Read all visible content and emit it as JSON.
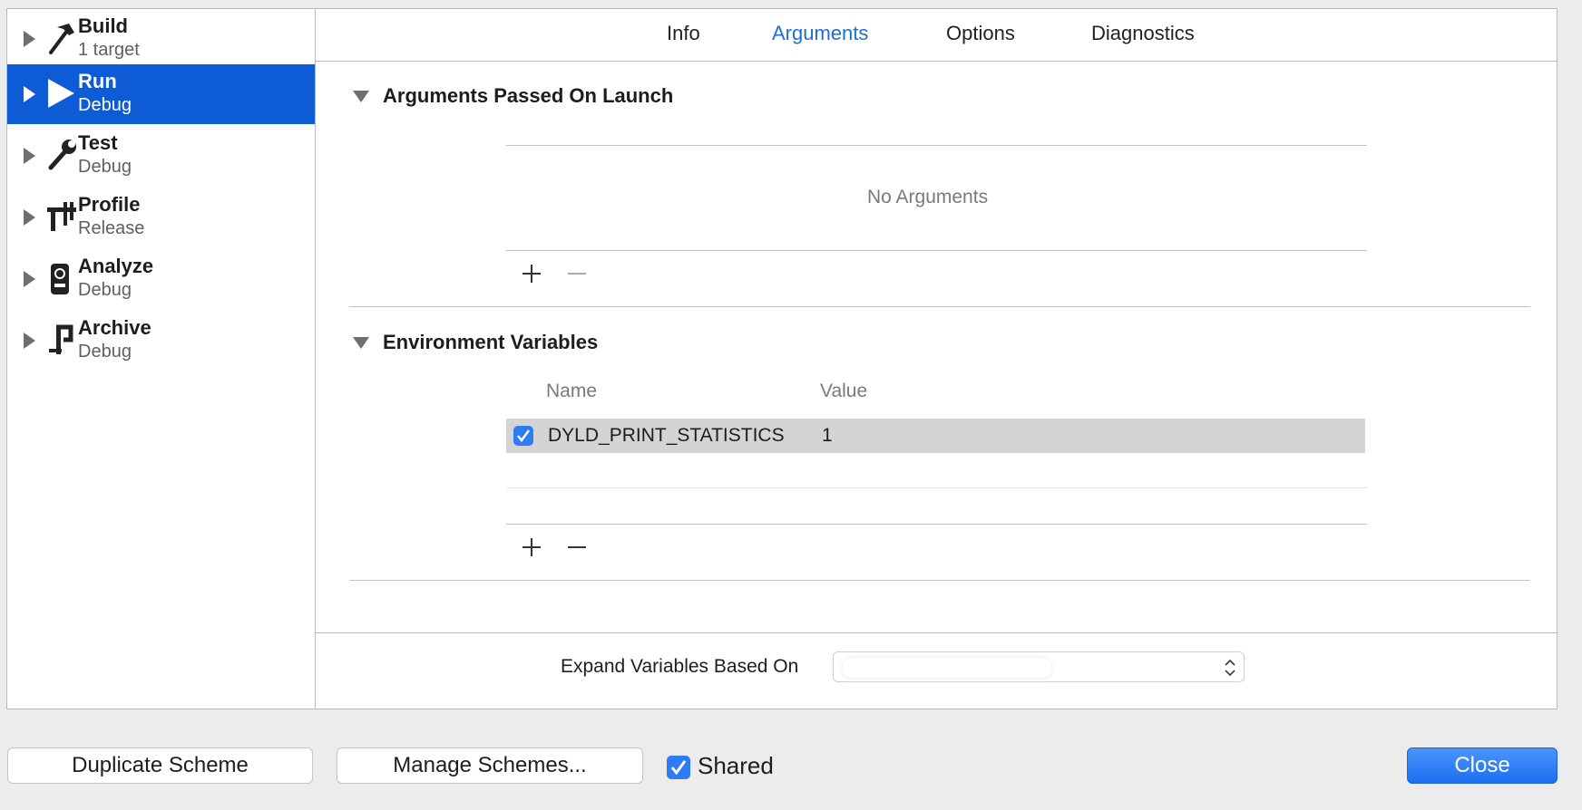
{
  "sidebar": {
    "items": [
      {
        "title": "Build",
        "subtitle": "1 target",
        "icon": "hammer-icon",
        "selected": false
      },
      {
        "title": "Run",
        "subtitle": "Debug",
        "icon": "play-icon",
        "selected": true
      },
      {
        "title": "Test",
        "subtitle": "Debug",
        "icon": "wrench-icon",
        "selected": false
      },
      {
        "title": "Profile",
        "subtitle": "Release",
        "icon": "caliper-icon",
        "selected": false
      },
      {
        "title": "Analyze",
        "subtitle": "Debug",
        "icon": "analyze-icon",
        "selected": false
      },
      {
        "title": "Archive",
        "subtitle": "Debug",
        "icon": "clamp-icon",
        "selected": false
      }
    ]
  },
  "tabs": [
    "Info",
    "Arguments",
    "Options",
    "Diagnostics"
  ],
  "active_tab": "Arguments",
  "arguments": {
    "title": "Arguments Passed On Launch",
    "empty_text": "No Arguments"
  },
  "environment": {
    "title": "Environment Variables",
    "columns": {
      "name": "Name",
      "value": "Value"
    },
    "rows": [
      {
        "enabled": true,
        "name": "DYLD_PRINT_STATISTICS",
        "value": "1"
      }
    ]
  },
  "expand_variables": {
    "label": "Expand Variables Based On",
    "selected": ""
  },
  "footer": {
    "duplicate_label": "Duplicate Scheme",
    "manage_label": "Manage Schemes...",
    "shared_label": "Shared",
    "shared_checked": true,
    "close_label": "Close"
  },
  "colors": {
    "selection": "#0e5bd6",
    "accent": "#1a6fd8",
    "checkbox": "#2d7cf6"
  }
}
